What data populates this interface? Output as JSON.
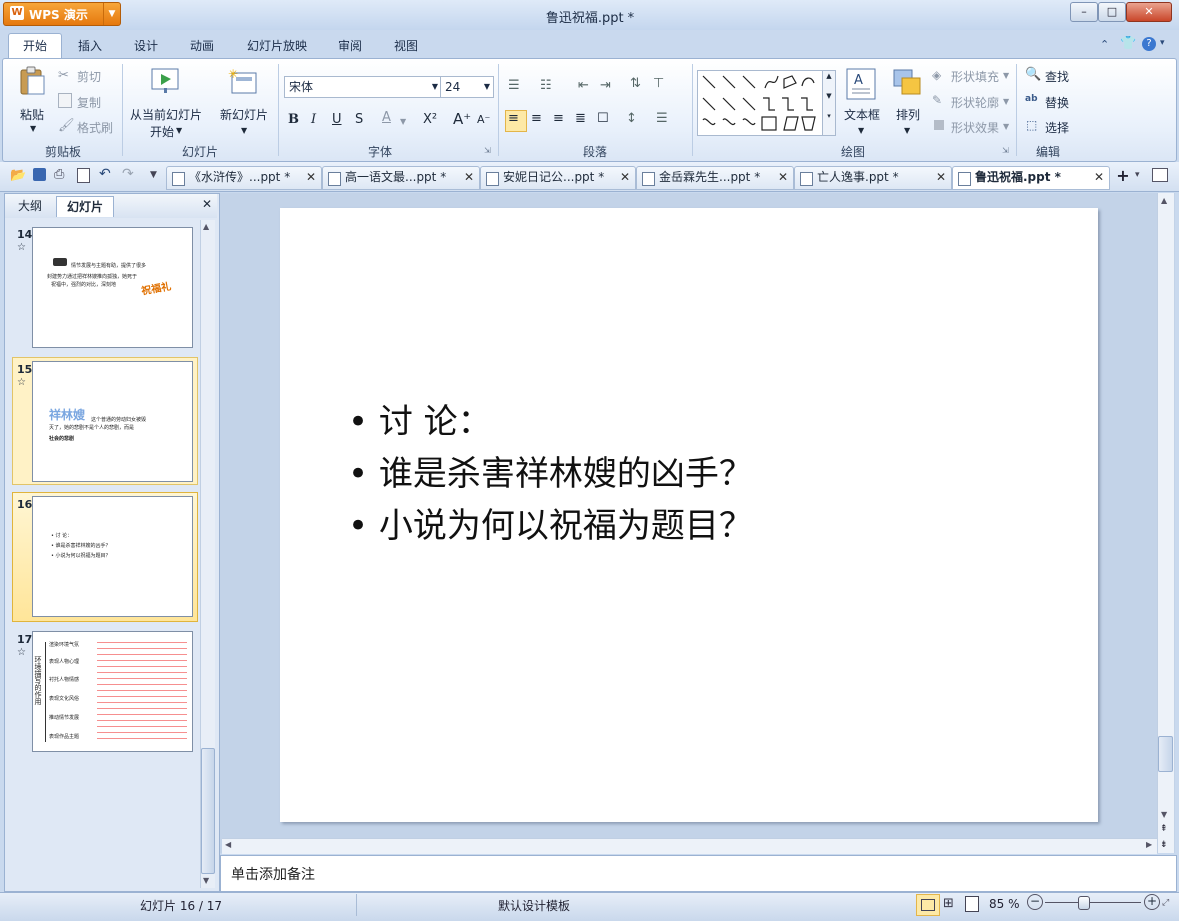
{
  "app": {
    "name": "WPS 演示",
    "doc_title": "鲁迅祝福.ppt *"
  },
  "menu": {
    "tabs": [
      "开始",
      "插入",
      "设计",
      "动画",
      "幻灯片放映",
      "审阅",
      "视图"
    ]
  },
  "ribbon": {
    "clipboard": {
      "paste": "粘贴",
      "cut": "剪切",
      "copy": "复制",
      "format_painter": "格式刷",
      "group": "剪贴板"
    },
    "slides": {
      "from_current": "从当前幻灯片",
      "start": "开始",
      "new_slide": "新幻灯片",
      "group": "幻灯片"
    },
    "font": {
      "name": "宋体",
      "size": "24",
      "group": "字体"
    },
    "paragraph": {
      "group": "段落"
    },
    "drawing": {
      "textbox": "文本框",
      "arrange": "排列",
      "shape_fill": "形状填充",
      "shape_outline": "形状轮廓",
      "shape_effect": "形状效果",
      "group": "绘图"
    },
    "edit": {
      "find": "查找",
      "replace": "替换",
      "select": "选择",
      "group": "编辑"
    }
  },
  "doc_tabs": [
    "《水浒传》...ppt *",
    "高一语文最...ppt *",
    "安妮日记公...ppt *",
    "金岳霖先生...ppt *",
    "亡人逸事.ppt *",
    "鲁迅祝福.ppt *"
  ],
  "left_pane": {
    "tabs": [
      "大纲",
      "幻灯片"
    ],
    "thumbs": [
      {
        "num": "14",
        "lines": [
          "情节发展与主题有助，提供了很多",
          "封建势力通过把祥林嫂推向孤独，她死于",
          "祝福中，强烈的对比，深刻地"
        ],
        "word": "祝福礼"
      },
      {
        "num": "15",
        "word": "祥林嫂",
        "lines": [
          "这个普通的劳动妇女被毁",
          "灭了，她的悲剧不是个人的悲剧，而是",
          "社会的悲剧"
        ]
      },
      {
        "num": "16",
        "lines": [
          "• 讨 论：",
          "• 谁是杀害祥林嫂的凶手？",
          "• 小说为何以祝福为题目？"
        ]
      },
      {
        "num": "17",
        "side": "环境描写的作用",
        "rows": [
          "渲染环境气氛",
          "表现人物心理",
          "衬托人物情感",
          "表现文化风俗",
          "推动情节发展",
          "表现作品主题"
        ]
      }
    ],
    "slide_icon": "☆"
  },
  "slide": {
    "bullets": [
      "讨 论：",
      "谁是杀害祥林嫂的凶手？",
      "小说为何以祝福为题目？"
    ]
  },
  "notes": {
    "placeholder": "单击添加备注"
  },
  "status": {
    "slide_pos": "幻灯片 16 / 17",
    "template": "默认设计模板",
    "zoom": "85 %"
  }
}
